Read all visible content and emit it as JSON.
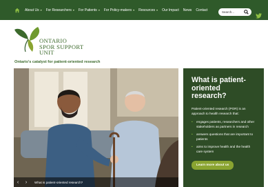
{
  "nav": {
    "items": [
      {
        "label": "About Us",
        "caret": true
      },
      {
        "label": "For Researchers",
        "caret": true
      },
      {
        "label": "For Patients",
        "caret": true
      },
      {
        "label": "For Policy-makers",
        "caret": true
      },
      {
        "label": "Resources",
        "caret": true
      },
      {
        "label": "Our Impact",
        "caret": false
      },
      {
        "label": "News",
        "caret": false
      },
      {
        "label": "Contact",
        "caret": false
      }
    ],
    "search_placeholder": "Search..."
  },
  "logo": {
    "line1": "ONTARIO",
    "line2": "SPOR SUPPORT",
    "line3": "UNIT"
  },
  "tagline": "Ontario's catalyst for patient-oriented research",
  "hero": {
    "caption": "What is patient-oriented research?",
    "prev": "‹",
    "next": "›"
  },
  "panel": {
    "title": "What is patient-oriented research?",
    "intro": "Patient-oriented research (POR) is an approach to health research that:",
    "bullets": [
      "engages patients, researchers and other stakeholders as partners in research",
      "answers questions that are important to patients",
      "aims to improve health and the health care system"
    ],
    "button": "Learn more about us"
  },
  "colors": {
    "nav_bg": "#2f5a2a",
    "panel_bg": "#2e4c26",
    "brand_green": "#3c6a2c",
    "accent": "#8aa431"
  }
}
